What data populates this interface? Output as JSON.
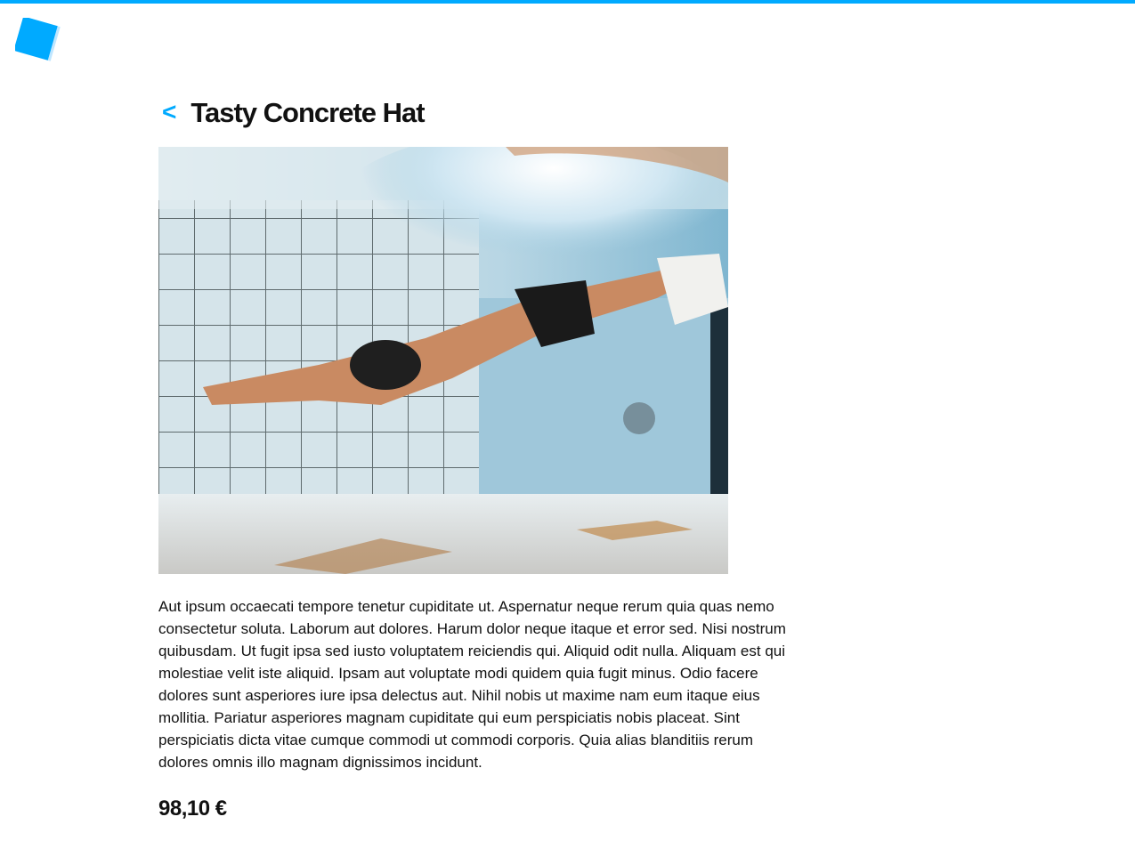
{
  "app": {
    "accent_color": "#00aaff",
    "logo_icon": "square-logo-icon"
  },
  "header": {
    "back_label": "<"
  },
  "product": {
    "title": "Tasty Concrete Hat",
    "image_alt": "Underwater swimmer diving in a tiled pool",
    "description": "Aut ipsum occaecati tempore tenetur cupiditate ut. Aspernatur neque rerum quia quas nemo consectetur soluta. Laborum aut dolores. Harum dolor neque itaque et error sed. Nisi nostrum quibusdam. Ut fugit ipsa sed iusto voluptatem reiciendis qui. Aliquid odit nulla. Aliquam est qui molestiae velit iste aliquid. Ipsam aut voluptate modi quidem quia fugit minus. Odio facere dolores sunt asperiores iure ipsa delectus aut. Nihil nobis ut maxime nam eum itaque eius mollitia. Pariatur asperiores magnam cupiditate qui eum perspiciatis nobis placeat. Sint perspiciatis dicta vitae cumque commodi ut commodi corporis. Quia alias blanditiis rerum dolores omnis illo magnam dignissimos incidunt.",
    "price": "98,10 €"
  }
}
